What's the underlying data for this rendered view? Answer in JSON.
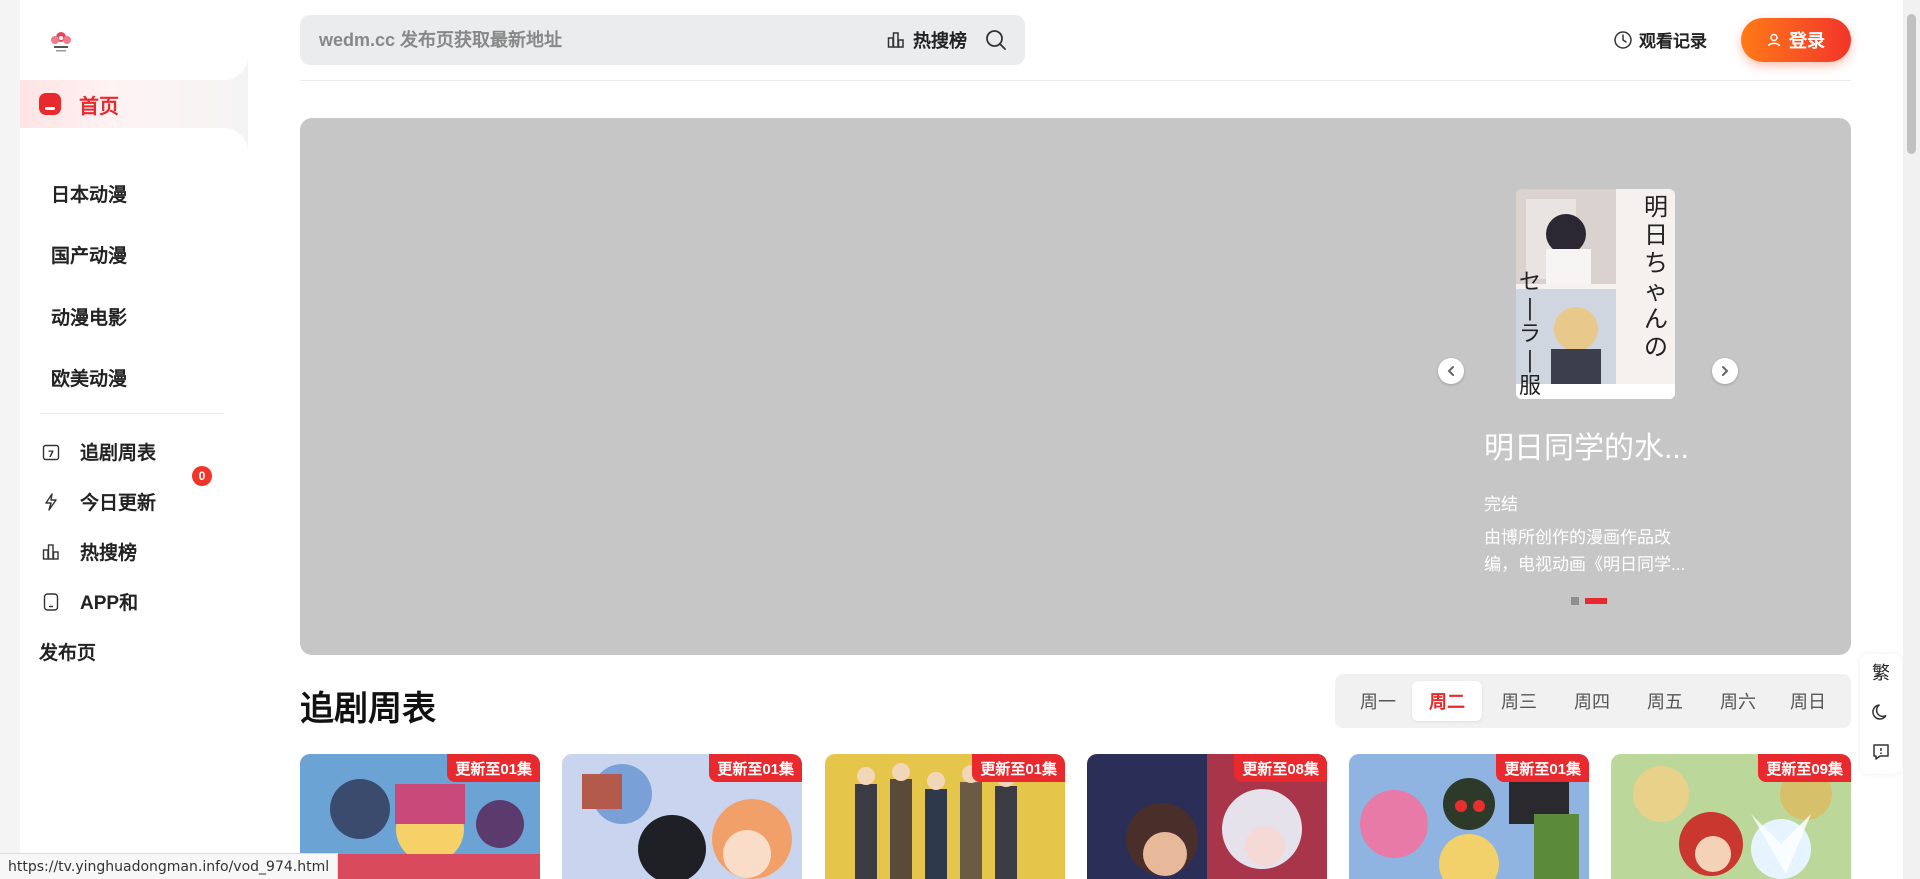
{
  "sidebar": {
    "home_label": "首页",
    "categories": [
      "日本动漫",
      "国产动漫",
      "动漫电影",
      "欧美动漫"
    ],
    "nav": [
      {
        "label": "追剧周表",
        "icon": "calendar-icon"
      },
      {
        "label": "今日更新",
        "icon": "lightning-icon",
        "badge": "0"
      },
      {
        "label": "热搜榜",
        "icon": "chart-icon"
      },
      {
        "label": "APP和",
        "icon": "phone-icon"
      }
    ],
    "extra_label": "发布页"
  },
  "header": {
    "search_placeholder": "wedm.cc 发布页获取最新地址",
    "hot_label": "热搜榜",
    "history_label": "观看记录",
    "login_label": "登录"
  },
  "banner": {
    "title": "明日同学的水...",
    "status": "完结",
    "description": "由博所创作的漫画作品改编，电视动画《明日同学...",
    "poster_text": "明日ちゃんのセーラー服",
    "dots": 2,
    "active_dot": 1
  },
  "schedule": {
    "title": "追剧周表",
    "days": [
      "周一",
      "周二",
      "周三",
      "周四",
      "周五",
      "周六",
      "周日"
    ],
    "active_day": 1,
    "cards": [
      {
        "tag": "更新至01集",
        "color": "#c94a7a"
      },
      {
        "tag": "更新至01集",
        "color": "#7a8fc4"
      },
      {
        "tag": "更新至01集",
        "color": "#c9a94a"
      },
      {
        "tag": "更新至08集",
        "color": "#3b3f6e"
      },
      {
        "tag": "更新至01集",
        "color": "#4a6fb0"
      },
      {
        "tag": "更新至09集",
        "color": "#8bb06a"
      }
    ]
  },
  "float_tools": {
    "traditional_label": "繁",
    "moon": "moon-icon",
    "feedback": "chat-icon"
  },
  "status_url": "https://tv.yinghuadongman.info/vod_974.html",
  "colors": {
    "accent": "#e8292d",
    "login_gradient_start": "#ff7a17",
    "login_gradient_end": "#f2352b",
    "banner_bg": "#c6c6c6"
  }
}
